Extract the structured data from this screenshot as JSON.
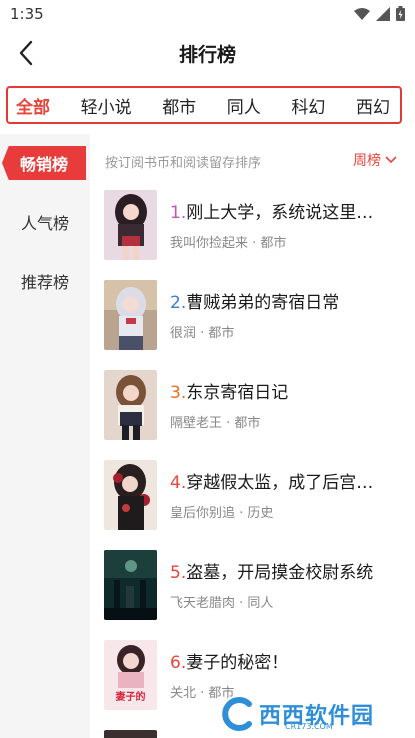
{
  "status_bar": {
    "time": "1:35"
  },
  "header": {
    "title": "排行榜"
  },
  "categories": [
    "全部",
    "轻小说",
    "都市",
    "同人",
    "科幻",
    "西幻"
  ],
  "sidebar": {
    "items": [
      "畅销榜",
      "人气榜",
      "推荐榜"
    ]
  },
  "list": {
    "hint": "按订阅书币和阅读留存排序",
    "period": "周榜",
    "books": [
      {
        "rank": "1.",
        "title": "刚上大学，系统说这里…",
        "meta": "我叫你捡起来 · 都市"
      },
      {
        "rank": "2.",
        "title": "曹贼弟弟的寄宿日常",
        "meta": "很润 · 都市"
      },
      {
        "rank": "3.",
        "title": "东京寄宿日记",
        "meta": "隔壁老王 · 都市"
      },
      {
        "rank": "4.",
        "title": "穿越假太监，成了后宫…",
        "meta": "皇后你别追 · 历史"
      },
      {
        "rank": "5.",
        "title": "盗墓，开局摸金校尉系统",
        "meta": "飞天老腊肉 · 同人"
      },
      {
        "rank": "6.",
        "title": "妻子的秘密！",
        "meta": "关北 · 都市"
      }
    ]
  },
  "cover_text": {
    "book6": "妻子的秘密"
  },
  "watermark": {
    "text": "西西软件园",
    "sub": "CR173.COM"
  },
  "colors": {
    "accent": "#e8453c",
    "sidebar_bg": "#f5f5f5"
  }
}
